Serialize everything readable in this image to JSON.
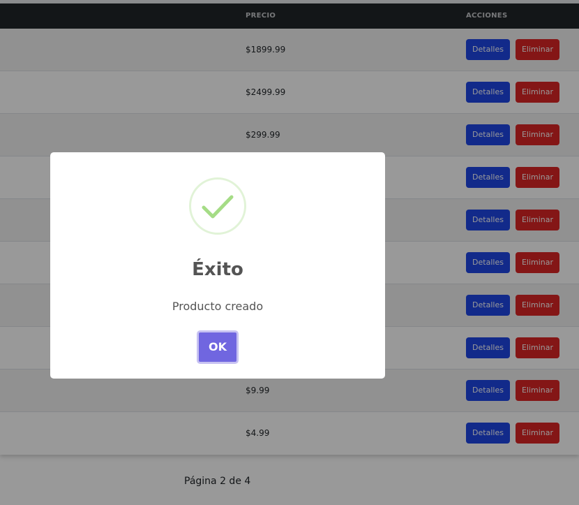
{
  "table": {
    "headers": {
      "price": "PRECIO",
      "actions": "ACCIONES"
    },
    "rows": [
      {
        "price": "$1899.99",
        "details_label": "Detalles",
        "delete_label": "Eliminar"
      },
      {
        "price": "$2499.99",
        "details_label": "Detalles",
        "delete_label": "Eliminar"
      },
      {
        "price": "$299.99",
        "details_label": "Detalles",
        "delete_label": "Eliminar"
      },
      {
        "price": "",
        "details_label": "Detalles",
        "delete_label": "Eliminar"
      },
      {
        "price": "",
        "details_label": "Detalles",
        "delete_label": "Eliminar"
      },
      {
        "price": "",
        "details_label": "Detalles",
        "delete_label": "Eliminar"
      },
      {
        "price": "",
        "details_label": "Detalles",
        "delete_label": "Eliminar"
      },
      {
        "price": "",
        "details_label": "Detalles",
        "delete_label": "Eliminar"
      },
      {
        "price": "$9.99",
        "details_label": "Detalles",
        "delete_label": "Eliminar"
      },
      {
        "price": "$4.99",
        "details_label": "Detalles",
        "delete_label": "Eliminar"
      }
    ]
  },
  "pagination": {
    "label": "Página 2 de 4"
  },
  "modal": {
    "icon": "success-check-icon",
    "title": "Éxito",
    "text": "Producto creado",
    "ok_label": "OK"
  },
  "colors": {
    "details_button": "#1f47e6",
    "delete_button": "#dc2626",
    "table_header": "#212529",
    "ok_button": "#7066e0",
    "success": "#a5dc86"
  }
}
